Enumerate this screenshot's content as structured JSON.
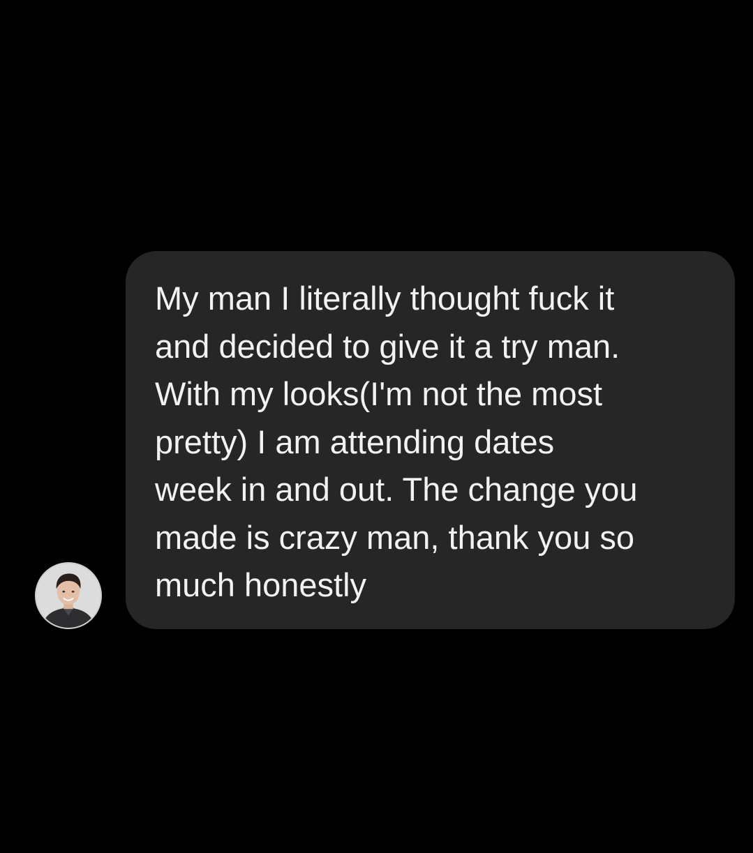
{
  "conversation": {
    "message": {
      "text": "My man I literally thought fuck it\nand decided to give it a try man.\nWith my looks(I'm not the most\npretty) I am attending dates\nweek in and out. The change you\nmade is crazy man, thank you so\nmuch honestly"
    },
    "sender": {
      "avatar_icon": "profile-photo-avatar"
    }
  },
  "colors": {
    "background": "#000000",
    "bubble": "#262626",
    "text": "#f2f2f2"
  }
}
